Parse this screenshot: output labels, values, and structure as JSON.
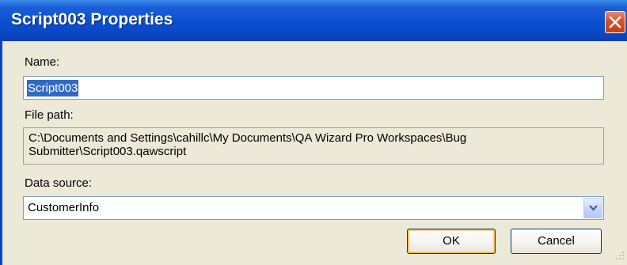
{
  "window": {
    "title": "Script003 Properties",
    "colors": {
      "titlebar": "#0a4fd0",
      "body": "#ece9d8",
      "selection": "#316ac5",
      "close": "#d6502c"
    }
  },
  "form": {
    "name_label": "Name:",
    "name_value": "Script003",
    "filepath_label": "File path:",
    "filepath_value": "C:\\Documents and Settings\\cahillc\\My Documents\\QA Wizard Pro Workspaces\\Bug Submitter\\Script003.qawscript",
    "datasource_label": "Data source:",
    "datasource_value": "CustomerInfo"
  },
  "buttons": {
    "ok_label": "OK",
    "cancel_label": "Cancel"
  },
  "icons": {
    "close": "close-icon",
    "dropdown": "chevron-down-icon",
    "grip": "resize-grip-icon"
  }
}
